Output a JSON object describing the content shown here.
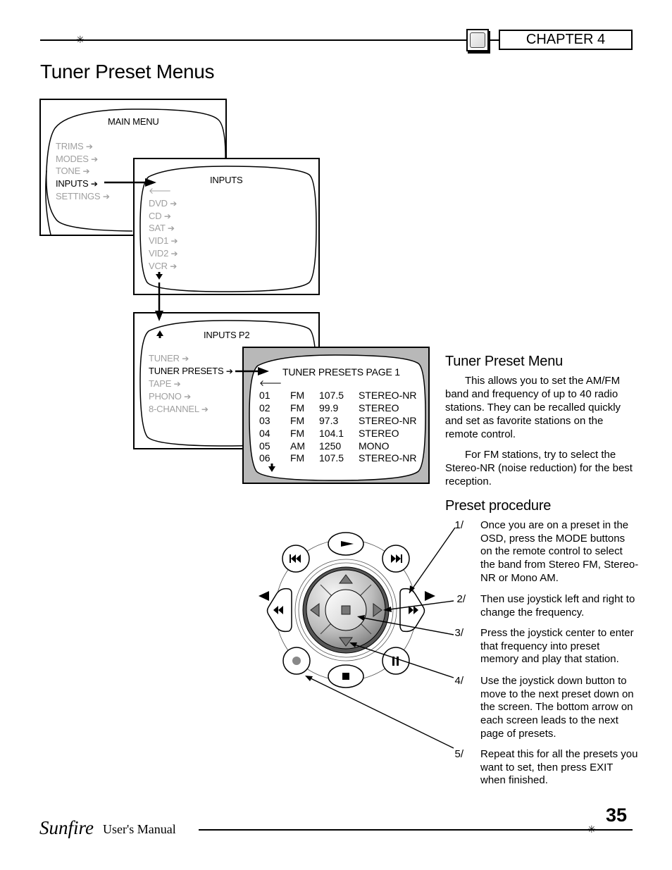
{
  "header": {
    "chapter_label": "CHAPTER 4",
    "page_title": "Tuner Preset Menus"
  },
  "osd_screens": {
    "main_menu": {
      "title": "MAIN MENU",
      "items": [
        {
          "label": "TRIMS",
          "active": false
        },
        {
          "label": "MODES",
          "active": false
        },
        {
          "label": "TONE",
          "active": false
        },
        {
          "label": "INPUTS",
          "active": true
        },
        {
          "label": "SETTINGS",
          "active": false
        }
      ]
    },
    "inputs": {
      "title": "INPUTS",
      "items": [
        {
          "label": "DVD",
          "active": false
        },
        {
          "label": "CD",
          "active": false
        },
        {
          "label": "SAT",
          "active": false
        },
        {
          "label": "VID1",
          "active": false
        },
        {
          "label": "VID2",
          "active": false
        },
        {
          "label": "VCR",
          "active": false
        }
      ]
    },
    "inputs_p2": {
      "title": "INPUTS P2",
      "items": [
        {
          "label": "TUNER",
          "active": false
        },
        {
          "label": "TUNER PRESETS",
          "active": true
        },
        {
          "label": "TAPE",
          "active": false
        },
        {
          "label": "PHONO",
          "active": false
        },
        {
          "label": "8-CHANNEL",
          "active": false
        }
      ]
    },
    "tuner_presets": {
      "title": "TUNER PRESETS PAGE 1",
      "rows": [
        {
          "num": "01",
          "band": "FM",
          "freq": "107.5",
          "mode": "STEREO-NR"
        },
        {
          "num": "02",
          "band": "FM",
          "freq": "99.9",
          "mode": "STEREO"
        },
        {
          "num": "03",
          "band": "FM",
          "freq": "97.3",
          "mode": "STEREO-NR"
        },
        {
          "num": "04",
          "band": "FM",
          "freq": "104.1",
          "mode": "STEREO"
        },
        {
          "num": "05",
          "band": "AM",
          "freq": "1250",
          "mode": "MONO"
        },
        {
          "num": "06",
          "band": "FM",
          "freq": "107.5",
          "mode": "STEREO-NR"
        }
      ]
    }
  },
  "tuner_preset_menu": {
    "heading": "Tuner Preset Menu",
    "paragraphs": [
      "This allows you to set the AM/FM band and frequency of up to 40 radio stations. They can be recalled quickly and set as favorite stations on the remote control.",
      "For FM stations, try to select the Stereo-NR (noise reduction) for the best reception."
    ]
  },
  "preset_procedure": {
    "heading": "Preset procedure",
    "steps": [
      {
        "num": "1/",
        "text": "Once you are on a preset in the OSD, press the MODE buttons on the remote control to select the band from Stereo FM, Stereo-NR or Mono AM."
      },
      {
        "num": "2/",
        "text": "Then use joystick left and right to change the frequency."
      },
      {
        "num": "3/",
        "text": "Press the joystick center to enter that frequency into preset memory and play that station."
      },
      {
        "num": "4/",
        "text": "Use the joystick down button to move to the next preset down on the screen. The bottom arrow on each screen leads to the next page of presets."
      },
      {
        "num": "5/",
        "text": "Repeat this for all the presets you want to set, then press EXIT when finished."
      }
    ]
  },
  "remote": {
    "buttons": [
      "play",
      "previous",
      "next",
      "rewind",
      "fast-forward",
      "record",
      "stop",
      "pause",
      "joystick-up",
      "joystick-down",
      "joystick-left",
      "joystick-right",
      "joystick-center"
    ],
    "mode_left_glyph": "◀",
    "mode_right_glyph": "▶"
  },
  "footer": {
    "brand": "Sunfire",
    "manual_label": "User's Manual",
    "page_number": "35"
  },
  "glyphs": {
    "star": "✳",
    "arrow_right": "➔",
    "arrow_left": "🡐"
  }
}
